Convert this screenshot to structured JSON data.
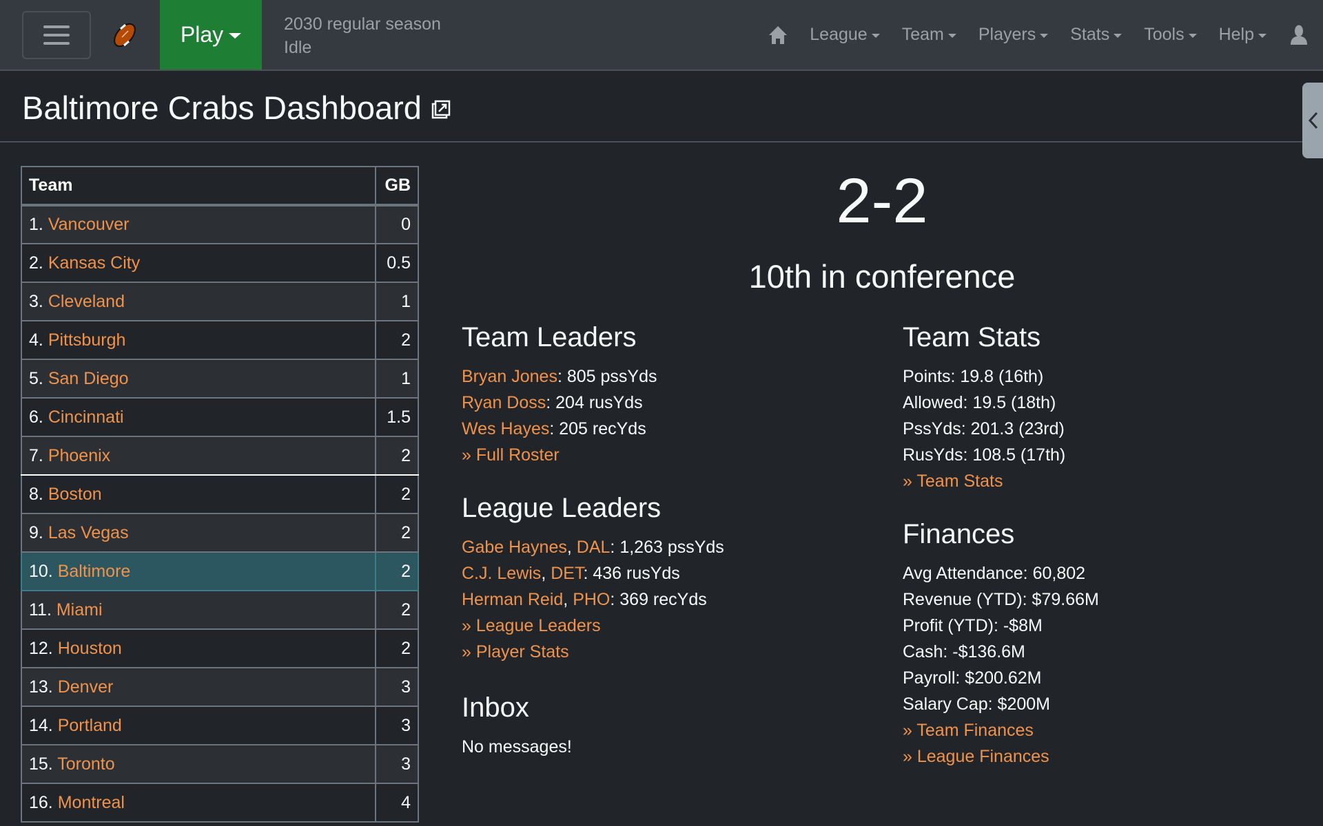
{
  "navbar": {
    "play_label": "Play",
    "season": "2030 regular season",
    "phase_status": "Idle",
    "menu_items": [
      {
        "label": "League"
      },
      {
        "label": "Team"
      },
      {
        "label": "Players"
      },
      {
        "label": "Stats"
      },
      {
        "label": "Tools"
      },
      {
        "label": "Help"
      }
    ],
    "icons": {
      "menu": "hamburger-icon",
      "logo": "football-icon",
      "home": "home-icon",
      "user": "user-icon"
    }
  },
  "page": {
    "title": "Baltimore Crabs Dashboard",
    "title_icon": "external-link-icon",
    "side_tab_icon": "chevron-left-icon"
  },
  "standings": {
    "headers": {
      "team": "Team",
      "gb": "GB"
    },
    "rows": [
      {
        "rank": "1.",
        "team": "Vancouver",
        "gb": "0"
      },
      {
        "rank": "2.",
        "team": "Kansas City",
        "gb": "0.5"
      },
      {
        "rank": "3.",
        "team": "Cleveland",
        "gb": "1"
      },
      {
        "rank": "4.",
        "team": "Pittsburgh",
        "gb": "2"
      },
      {
        "rank": "5.",
        "team": "San Diego",
        "gb": "1"
      },
      {
        "rank": "6.",
        "team": "Cincinnati",
        "gb": "1.5"
      },
      {
        "rank": "7.",
        "team": "Phoenix",
        "gb": "2"
      },
      {
        "rank": "8.",
        "team": "Boston",
        "gb": "2"
      },
      {
        "rank": "9.",
        "team": "Las Vegas",
        "gb": "2"
      },
      {
        "rank": "10.",
        "team": "Baltimore",
        "gb": "2"
      },
      {
        "rank": "11.",
        "team": "Miami",
        "gb": "2"
      },
      {
        "rank": "12.",
        "team": "Houston",
        "gb": "2"
      },
      {
        "rank": "13.",
        "team": "Denver",
        "gb": "3"
      },
      {
        "rank": "14.",
        "team": "Portland",
        "gb": "3"
      },
      {
        "rank": "15.",
        "team": "Toronto",
        "gb": "3"
      },
      {
        "rank": "16.",
        "team": "Montreal",
        "gb": "4"
      }
    ]
  },
  "summary": {
    "record": "2-2",
    "conference_rank": "10th in conference"
  },
  "team_leaders": {
    "title": "Team Leaders",
    "items": [
      {
        "name": "Bryan Jones",
        "stat": ": 805 pssYds"
      },
      {
        "name": "Ryan Doss",
        "stat": ": 204 rusYds"
      },
      {
        "name": "Wes Hayes",
        "stat": ": 205 recYds"
      }
    ],
    "link": "» Full Roster"
  },
  "league_leaders": {
    "title": "League Leaders",
    "items": [
      {
        "name": "Gabe Haynes",
        "team": "DAL",
        "stat": ": 1,263 pssYds"
      },
      {
        "name": "C.J. Lewis",
        "team": "DET",
        "stat": ": 436 rusYds"
      },
      {
        "name": "Herman Reid",
        "team": "PHO",
        "stat": ": 369 recYds"
      }
    ],
    "links": [
      "» League Leaders",
      "» Player Stats"
    ]
  },
  "inbox": {
    "title": "Inbox",
    "message": "No messages!"
  },
  "team_stats": {
    "title": "Team Stats",
    "lines": [
      "Points: 19.8 (16th)",
      "Allowed: 19.5 (18th)",
      "PssYds: 201.3 (23rd)",
      "RusYds: 108.5 (17th)"
    ],
    "link": "» Team Stats"
  },
  "finances": {
    "title": "Finances",
    "lines": [
      "Avg Attendance: 60,802",
      "Revenue (YTD): $79.66M",
      "Profit (YTD): -$8M",
      "Cash: -$136.6M",
      "Payroll: $200.62M",
      "Salary Cap: $200M"
    ],
    "links": [
      "» Team Finances",
      "» League Finances"
    ]
  },
  "colors": {
    "background": "#212529",
    "navbar": "#343a40",
    "play_button": "#1e7e34",
    "link": "#f0924a",
    "highlight_row": "#2d5760"
  }
}
